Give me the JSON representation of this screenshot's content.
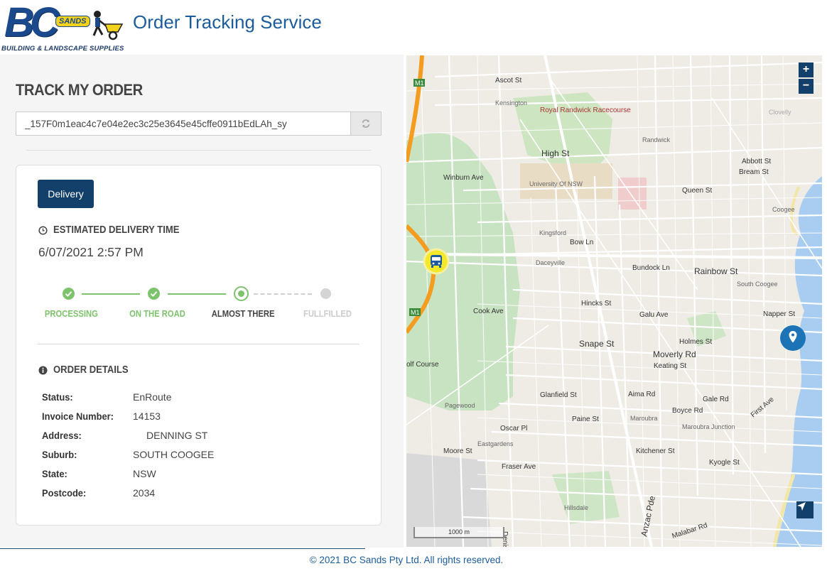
{
  "header": {
    "logo_text": "BC",
    "logo_badge": "SANDS",
    "logo_tagline": "BUILDING & LANDSCAPE SUPPLIES",
    "title": "Order Tracking Service"
  },
  "track": {
    "title": "TRACK MY ORDER",
    "order_id": "_157F0m1eac4c7e04e2ec3c25e3645e45cffe0911bEdLAh_sy",
    "refresh_icon": "refresh-icon"
  },
  "delivery": {
    "button_label": "Delivery",
    "eta_heading": "ESTIMATED DELIVERY TIME",
    "eta_icon": "clock-icon",
    "eta_value": "6/07/2021 2:57 PM",
    "steps": [
      {
        "label": "PROCESSING",
        "state": "done"
      },
      {
        "label": "ON THE ROAD",
        "state": "done"
      },
      {
        "label": "ALMOST THERE",
        "state": "current"
      },
      {
        "label": "FULLFILLED",
        "state": "pending"
      }
    ],
    "colors": {
      "done": "#7dc26c",
      "current_text": "#444444",
      "pending": "#cccccc"
    }
  },
  "order_details": {
    "heading": "ORDER DETAILS",
    "icon": "info-icon",
    "rows": [
      {
        "label": "Status:",
        "value": "EnRoute"
      },
      {
        "label": "Invoice Number:",
        "value": "14153"
      },
      {
        "label": "Address:",
        "value": "DENNING ST"
      },
      {
        "label": "Suburb:",
        "value": "SOUTH COOGEE"
      },
      {
        "label": "State:",
        "value": "NSW"
      },
      {
        "label": "Postcode:",
        "value": "2034"
      }
    ]
  },
  "map": {
    "zoom_in": "+",
    "zoom_out": "−",
    "scale_label": "1000 m",
    "labels": {
      "racecourse": "Royal Randwick Racecourse",
      "high_st": "High St",
      "winburn": "Winburn Ave",
      "rainbow": "Rainbow St",
      "bundock": "Bundock Ln",
      "snape": "Snape St",
      "moverly": "Moverly Rd",
      "cook": "Cook Ave",
      "randwick": "Randwick",
      "kingsford": "Kingsford",
      "daceyville": "Daceyville",
      "maroubra": "Maroubra",
      "maroubra_junction": "Maroubra Junction",
      "south_coogee": "South Coogee",
      "coogee": "Coogee",
      "clovelly": "Clovelly",
      "kensington": "Kensington",
      "pagewood": "Pagewood",
      "eastgardens": "Eastgardens",
      "hillsdale": "Hillsdale",
      "unsw": "University Of NSW",
      "anzac": "Anzac Pde",
      "queen": "Queen St",
      "bream": "Bream St",
      "abbott": "Abbott St",
      "napper": "Napper St",
      "galu": "Galu Ave",
      "aima": "Aima Rd",
      "boyce": "Boyce Rd",
      "gale": "Gale Rd",
      "fraser": "Fraser Ave",
      "kitchener": "Kitchener St",
      "malabar": "Malabar Rd",
      "golf": "olf Course",
      "m1": "M1",
      "ascot": "Ascot St",
      "denison": "Denison St",
      "bow": "Bow Ln",
      "hinks": "Hincks St",
      "glanfield": "Glanfield St",
      "paine": "Paine St",
      "oscar": "Oscar Pl",
      "moore": "Moore St",
      "first_ave": "First Ave",
      "kyogle": "Kyogle St",
      "holmes": "Holmes St",
      "keating": "Keating St"
    }
  },
  "footer": "© 2021 BC Sands Pty Ltd. All rights reserved."
}
